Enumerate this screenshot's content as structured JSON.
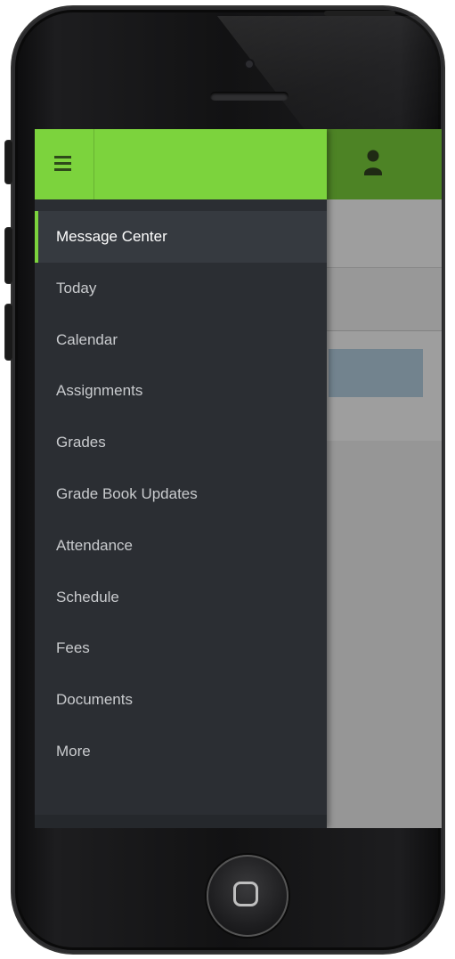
{
  "app": {
    "accent_color": "#7cd33d",
    "drawer_color": "#2b2e33"
  },
  "header": {
    "menu_icon": "hamburger-menu-icon",
    "user_icon": "user-icon"
  },
  "nav": {
    "items": [
      {
        "label": "Message Center",
        "active": true
      },
      {
        "label": "Today",
        "active": false
      },
      {
        "label": "Calendar",
        "active": false
      },
      {
        "label": "Assignments",
        "active": false
      },
      {
        "label": "Grades",
        "active": false
      },
      {
        "label": "Grade Book Updates",
        "active": false
      },
      {
        "label": "Attendance",
        "active": false
      },
      {
        "label": "Schedule",
        "active": false
      },
      {
        "label": "Fees",
        "active": false
      },
      {
        "label": "Documents",
        "active": false
      },
      {
        "label": "More",
        "active": false
      }
    ]
  },
  "device": {
    "home_icon": "home-button-icon"
  }
}
